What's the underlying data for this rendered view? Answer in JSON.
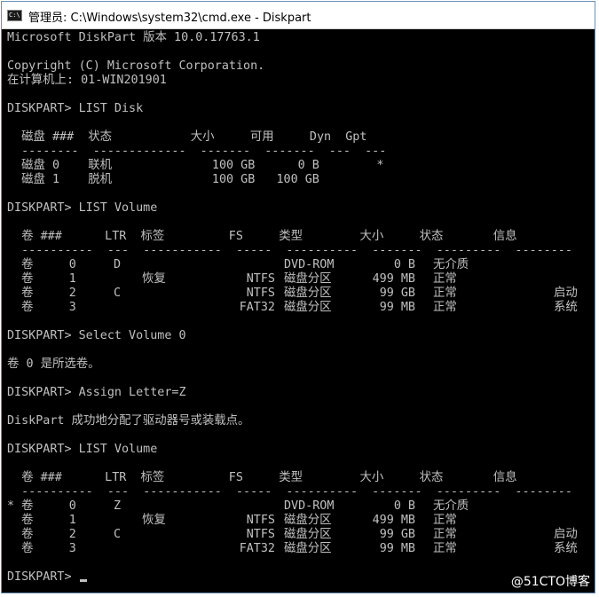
{
  "window": {
    "title": "管理员: C:\\Windows\\system32\\cmd.exe - Diskpart",
    "icon": "cmd-icon"
  },
  "console": {
    "lines": [
      "Microsoft DiskPart 版本 10.0.17763.1",
      "Copyright (C) Microsoft Corporation.",
      "在计算机上: 01-WIN201901",
      "DISKPART> LIST Disk",
      "DISKPART> LIST Volume",
      "DISKPART> Select Volume 0",
      "卷 0 是所选卷。",
      "DISKPART> Assign Letter=Z",
      "DiskPart 成功地分配了驱动器号或装载点。",
      "DISKPART> LIST Volume",
      "DISKPART> "
    ],
    "disk_table": {
      "header": "  磁盘 ###  状态           大小     可用     Dyn  Gpt",
      "separator": "  --------  -------------  -------  -------  ---  ---",
      "rows": [
        "  磁盘 0    联机              100 GB      0 B        *",
        "  磁盘 1    脱机              100 GB   100 GB"
      ]
    },
    "volume_table_1": {
      "header": "  卷 ###      LTR  标签         FS     类型        大小     状态       信息",
      "separator": "  ----------  ---  -----------  -----  ----------  -------  ---------  --------",
      "rows": [
        {
          "marker": " ",
          "num": "卷     0",
          "ltr": "D",
          "label": "",
          "fs": "",
          "type": "DVD-ROM",
          "size": "0 B",
          "status": "无介质",
          "info": ""
        },
        {
          "marker": " ",
          "num": "卷     1",
          "ltr": "",
          "label": "恢复",
          "fs": "NTFS",
          "type": "磁盘分区",
          "size": "499 MB",
          "status": "正常",
          "info": ""
        },
        {
          "marker": " ",
          "num": "卷     2",
          "ltr": "C",
          "label": "",
          "fs": "NTFS",
          "type": "磁盘分区",
          "size": "99 GB",
          "status": "正常",
          "info": "启动"
        },
        {
          "marker": " ",
          "num": "卷     3",
          "ltr": "",
          "label": "",
          "fs": "FAT32",
          "type": "磁盘分区",
          "size": "99 MB",
          "status": "正常",
          "info": "系统"
        }
      ]
    },
    "volume_table_2": {
      "header": "  卷 ###      LTR  标签         FS     类型        大小     状态       信息",
      "separator": "  ----------  ---  -----------  -----  ----------  -------  ---------  --------",
      "rows": [
        {
          "marker": "*",
          "num": "卷     0",
          "ltr": "Z",
          "label": "",
          "fs": "",
          "type": "DVD-ROM",
          "size": "0 B",
          "status": "无介质",
          "info": ""
        },
        {
          "marker": " ",
          "num": "卷     1",
          "ltr": "",
          "label": "恢复",
          "fs": "NTFS",
          "type": "磁盘分区",
          "size": "499 MB",
          "status": "正常",
          "info": ""
        },
        {
          "marker": " ",
          "num": "卷     2",
          "ltr": "C",
          "label": "",
          "fs": "NTFS",
          "type": "磁盘分区",
          "size": "99 GB",
          "status": "正常",
          "info": "启动"
        },
        {
          "marker": " ",
          "num": "卷     3",
          "ltr": "",
          "label": "",
          "fs": "FAT32",
          "type": "磁盘分区",
          "size": "99 MB",
          "status": "正常",
          "info": "系统"
        }
      ]
    }
  },
  "watermark": "@51CTO博客"
}
